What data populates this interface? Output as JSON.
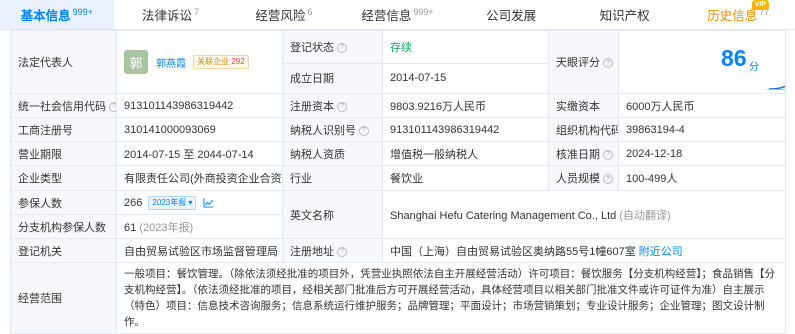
{
  "tabs": [
    {
      "label": "基本信息",
      "count": "999+"
    },
    {
      "label": "法律诉讼",
      "count": "7"
    },
    {
      "label": "经营风险",
      "count": "6"
    },
    {
      "label": "经营信息",
      "count": "999+"
    },
    {
      "label": "公司发展",
      "count": ""
    },
    {
      "label": "知识产权",
      "count": ""
    },
    {
      "label": "历史信息",
      "count": "77",
      "badge": "VIP"
    }
  ],
  "legal_rep": {
    "label": "法定代表人",
    "avatar_char": "郭",
    "name": "郭燕霞",
    "related_label": "关联企业",
    "related_count": "292"
  },
  "reg_status": {
    "label": "登记状态",
    "value": "存续"
  },
  "established": {
    "label": "成立日期",
    "value": "2014-07-15"
  },
  "tianyan": {
    "label": "天眼评分",
    "score": "86",
    "unit": "分"
  },
  "credit_code": {
    "label": "统一社会信用代码",
    "value": "913101143986319442"
  },
  "reg_capital": {
    "label": "注册资本",
    "value": "9803.9216万人民币"
  },
  "paid_capital": {
    "label": "实缴资本",
    "value": "6000万人民币"
  },
  "reg_no": {
    "label": "工商注册号",
    "value": "310141000093069"
  },
  "taxpayer_id": {
    "label": "纳税人识别号",
    "value": "913101143986319442"
  },
  "org_code": {
    "label": "组织机构代码",
    "value": "39863194-4"
  },
  "term": {
    "label": "营业期限",
    "value": "2014-07-15 至 2044-07-14"
  },
  "taxpayer_qual": {
    "label": "纳税人资质",
    "value": "增值税一般纳税人"
  },
  "approval_date": {
    "label": "核准日期",
    "value": "2024-12-18"
  },
  "company_type": {
    "label": "企业类型",
    "value": "有限责任公司(外商投资企业合资)"
  },
  "industry": {
    "label": "行业",
    "value": "餐饮业"
  },
  "staff_size": {
    "label": "人员规模",
    "value": "100-499人"
  },
  "insured": {
    "label": "参保人数",
    "value": "266",
    "badge": "2023年报"
  },
  "branch_insured": {
    "label": "分支机构参保人数",
    "value": "61",
    "note": "(2023年报)"
  },
  "english_name": {
    "label": "英文名称",
    "value": "Shanghai Hefu Catering Management Co., Ltd",
    "note": "(自动翻译)"
  },
  "reg_authority": {
    "label": "登记机关",
    "value": "自由贸易试验区市场监督管理局"
  },
  "address": {
    "label": "注册地址",
    "value": "中国（上海）自由贸易试验区奥纳路55号1幢607室",
    "link": "附近公司"
  },
  "scope": {
    "label": "经营范围",
    "value": "一般项目：餐饮管理。（除依法须经批准的项目外，凭营业执照依法自主开展经营活动）许可项目：餐饮服务【分支机构经营】；食品销售【分支机构经营】。（依法须经批准的项目，经相关部门批准后方可开展经营活动，具体经营项目以相关部门批准文件或许可证件为准）自主展示（特色）项目：信息技术咨询服务；信息系统运行维护服务；品牌管理；平面设计；市场营销策划；专业设计服务；企业管理；图文设计制作。"
  },
  "colors": {
    "accent": "#0084ff",
    "status_green": "#09a55b",
    "label_bg": "#f6f8fb",
    "border": "#e4e9f1"
  }
}
